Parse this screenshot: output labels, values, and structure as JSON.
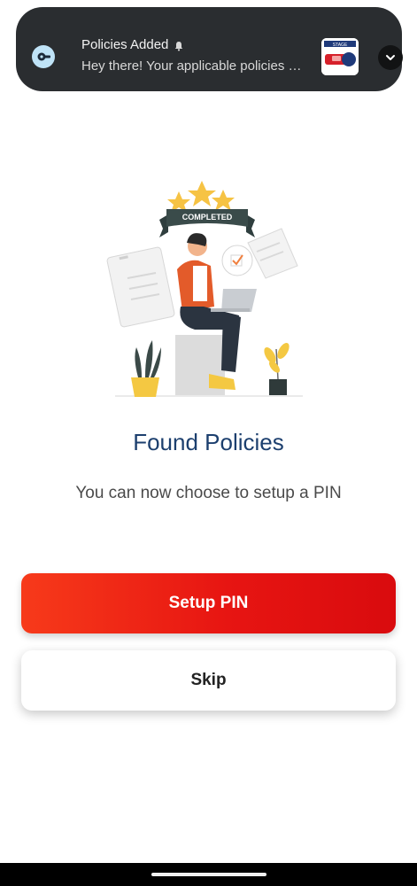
{
  "notification": {
    "title": "Policies Added",
    "body": "Hey there! Your applicable policies are now added to your account",
    "thumbnail_label": "STAGE",
    "icons": {
      "app": "key-icon",
      "bell": "bell-icon",
      "expand": "chevron-down-icon"
    }
  },
  "illustration": {
    "badge_text": "COMPLETED",
    "icon": "person-with-laptop-illustration"
  },
  "main": {
    "heading": "Found Policies",
    "subtext": "You can now choose to setup a PIN"
  },
  "buttons": {
    "primary_label": "Setup PIN",
    "secondary_label": "Skip"
  },
  "colors": {
    "heading": "#1c3f6e",
    "primary_button": "#e71512",
    "notification_bg": "#2a2d30"
  }
}
